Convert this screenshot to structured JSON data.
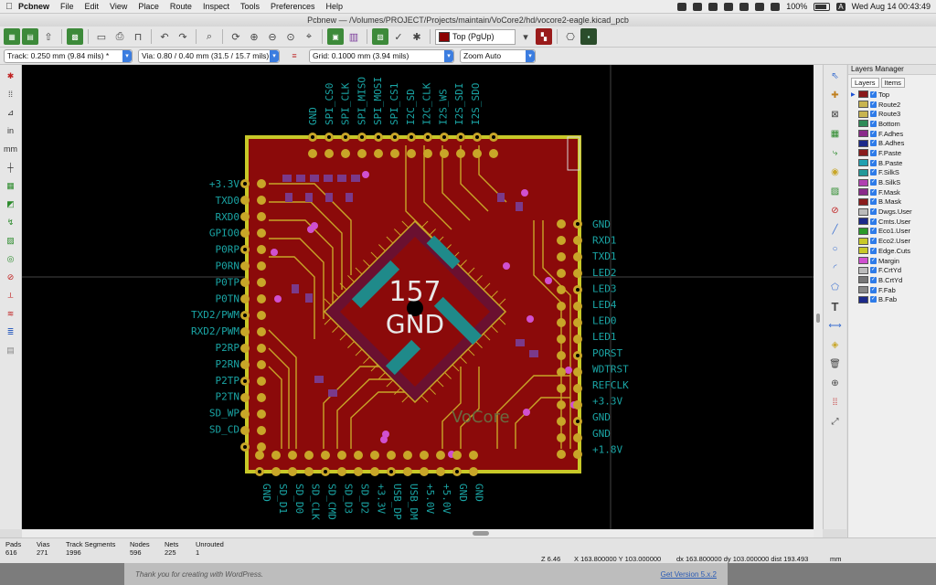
{
  "menubar": {
    "app": "Pcbnew",
    "items": [
      "File",
      "Edit",
      "View",
      "Place",
      "Route",
      "Inspect",
      "Tools",
      "Preferences",
      "Help"
    ],
    "battery": "100%",
    "keyboard": "A",
    "clock": "Wed Aug 14  00:43:49"
  },
  "window": {
    "title": "Pcbnew — /Volumes/PROJECT/Projects/maintain/VoCore2/hd/vocore2-eagle.kicad_pcb"
  },
  "toolbar1": {
    "active_layer": "Top (PgUp)"
  },
  "toolbar2": {
    "track": "Track: 0.250 mm (9.84 mils) *",
    "via": "Via: 0.80 / 0.40 mm (31.5 / 15.7 mils) *",
    "grid": "Grid: 0.1000 mm (3.94 mils)",
    "zoom": "Zoom Auto"
  },
  "board": {
    "top_labels": [
      "GND",
      "SPI_CS0",
      "SPI_CLK",
      "SPI_MISO",
      "SPI_MOSI",
      "SPI_CS1",
      "I2C_SD",
      "I2C_CLK",
      "I2S_WS",
      "I2S_SDI",
      "I2S_SDO"
    ],
    "left_labels": [
      "+3.3V",
      "TXD0",
      "RXD0",
      "GPIO0",
      "P0RP",
      "P0RN",
      "P0TP",
      "P0TN",
      "TXD2/PWM",
      "RXD2/PWM",
      "P2RP",
      "P2RN",
      "P2TP",
      "P2TN",
      "SD_WP",
      "SD_CD"
    ],
    "right_labels": [
      "GND",
      "RXD1",
      "TXD1",
      "LED2",
      "LED3",
      "LED4",
      "LED0",
      "LED1",
      "PORST",
      "WDTRST",
      "REFCLK",
      "+3.3V",
      "GND",
      "GND",
      "+1.8V"
    ],
    "bottom_labels": [
      "GND",
      "SD_D1",
      "SD_D0",
      "SD_CLK",
      "SD_CMD",
      "SD_D3",
      "SD_D2",
      "+3.3V",
      "USB_DP",
      "USB_DM",
      "+5.0V",
      "+5.0V",
      "GND",
      "GND"
    ],
    "center_number": "157",
    "center_net": "GND",
    "silk_text": "VoCore"
  },
  "layers_manager": {
    "title": "Layers Manager",
    "tabs": [
      "Layers",
      "Items"
    ],
    "layers": [
      {
        "name": "Top",
        "color": "#8b1a1a"
      },
      {
        "name": "Route2",
        "color": "#c8b450"
      },
      {
        "name": "Route3",
        "color": "#c8b450"
      },
      {
        "name": "Bottom",
        "color": "#2e8b57"
      },
      {
        "name": "F.Adhes",
        "color": "#8a2b8a"
      },
      {
        "name": "B.Adhes",
        "color": "#1c2a8a"
      },
      {
        "name": "F.Paste",
        "color": "#8a1c1c"
      },
      {
        "name": "B.Paste",
        "color": "#22a0b0"
      },
      {
        "name": "F.SilkS",
        "color": "#229999"
      },
      {
        "name": "B.SilkS",
        "color": "#b040b0"
      },
      {
        "name": "F.Mask",
        "color": "#8a2b8a"
      },
      {
        "name": "B.Mask",
        "color": "#8a1c1c"
      },
      {
        "name": "Dwgs.User",
        "color": "#bbbbbb"
      },
      {
        "name": "Cmts.User",
        "color": "#1c2a8a"
      },
      {
        "name": "Eco1.User",
        "color": "#2a9a2a"
      },
      {
        "name": "Eco2.User",
        "color": "#c8c828"
      },
      {
        "name": "Edge.Cuts",
        "color": "#c8c828"
      },
      {
        "name": "Margin",
        "color": "#d050d0"
      },
      {
        "name": "F.CrtYd",
        "color": "#bbbbbb"
      },
      {
        "name": "B.CrtYd",
        "color": "#777777"
      },
      {
        "name": "F.Fab",
        "color": "#888888"
      },
      {
        "name": "B.Fab",
        "color": "#1c2a8a"
      }
    ]
  },
  "status": {
    "columns": [
      {
        "label": "Pads",
        "value": "616"
      },
      {
        "label": "Vias",
        "value": "271"
      },
      {
        "label": "Track Segments",
        "value": "1996"
      },
      {
        "label": "Nodes",
        "value": "596"
      },
      {
        "label": "Nets",
        "value": "225"
      },
      {
        "label": "Unrouted",
        "value": "1"
      }
    ],
    "zoom": "Z 6.46",
    "xy": "X 163.800000  Y 103.000000",
    "dxy": "dx 163.800000  dy 103.000000  dist 193.493",
    "unit": "mm"
  },
  "bottom": {
    "left": "Thank you for creating with WordPress.",
    "right": "Get Version 5.x.2"
  }
}
